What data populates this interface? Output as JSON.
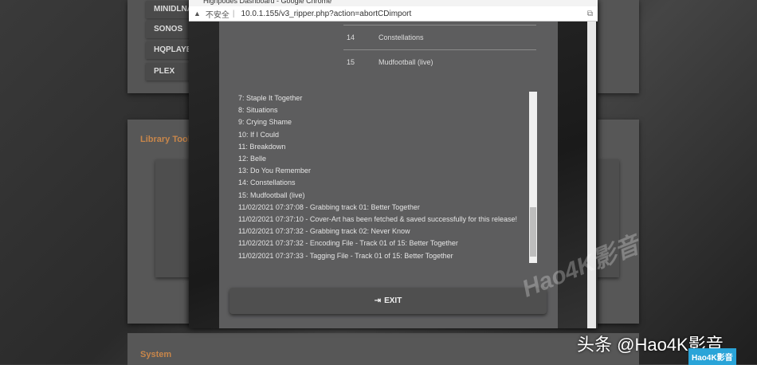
{
  "dashboard": {
    "nav": [
      "MINIDLNA",
      "SONOS",
      "HQPLAYER",
      "PLEX"
    ],
    "sections": [
      "Library Tools",
      "System"
    ]
  },
  "browser": {
    "title": "Highpodes Dashboard - Google Chrome",
    "security": "不安全",
    "url": "10.0.1.155/v3_ripper.php?action=abortCDimport"
  },
  "tracks": [
    {
      "n": "14",
      "title": "Constellations"
    },
    {
      "n": "15",
      "title": "Mudfootball (live)"
    }
  ],
  "log": [
    "7: Staple It Together",
    "8: Situations",
    "9: Crying Shame",
    "10: If I Could",
    "11: Breakdown",
    "12: Belle",
    "13: Do You Remember",
    "14: Constellations",
    "15: Mudfootball (live)",
    "11/02/2021 07:37:08 - Grabbing track 01: Better Together",
    "11/02/2021 07:37:10 - Cover-Art has been fetched & saved successfully for this release!",
    "11/02/2021 07:37:32 - Grabbing track 02: Never Know",
    "11/02/2021 07:37:32 - Encoding File - Track 01 of 15: Better Together",
    "11/02/2021 07:37:33 - Tagging File - Track 01 of 15: Better Together"
  ],
  "exit_label": "EXIT",
  "watermark": {
    "main": "Hao4K影音",
    "credit": "头条 @Hao4K影音",
    "badge": "Hao4K影音"
  }
}
